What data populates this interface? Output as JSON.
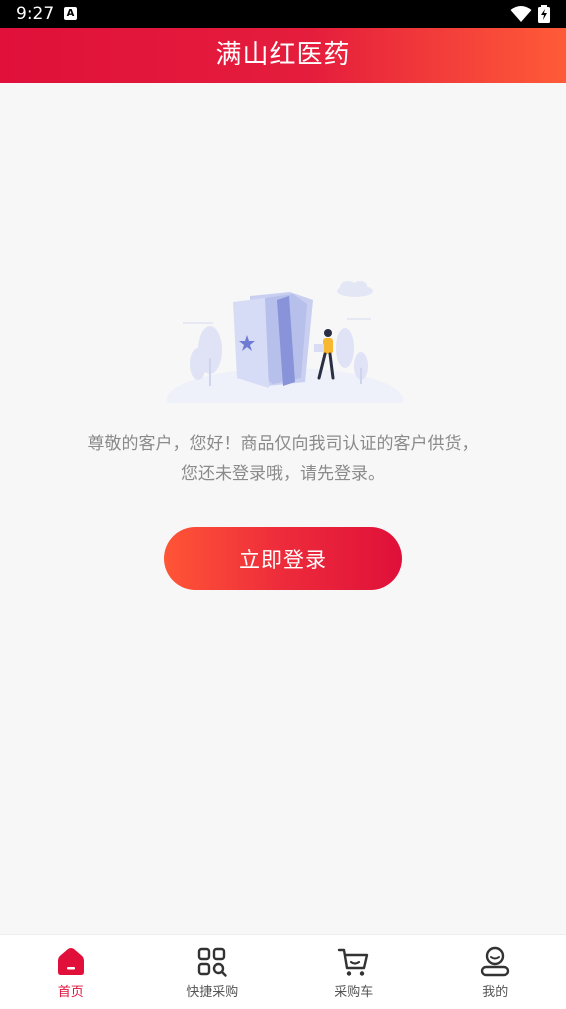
{
  "status_bar": {
    "time": "9:27",
    "notification_icon": "A"
  },
  "header": {
    "title": "满山红医药"
  },
  "illustration": {
    "icon": "open-book-person-illustration"
  },
  "main": {
    "message": "尊敬的客户，您好！商品仅向我司认证的客户供货，您还未登录哦，请先登录。",
    "login_button": "立即登录"
  },
  "tabbar": {
    "active_color": "#e0103a",
    "items": [
      {
        "label": "首页",
        "icon": "home-icon",
        "active": true
      },
      {
        "label": "快捷采购",
        "icon": "quick-purchase-icon",
        "active": false
      },
      {
        "label": "采购车",
        "icon": "cart-icon",
        "active": false
      },
      {
        "label": "我的",
        "icon": "profile-icon",
        "active": false
      }
    ]
  }
}
